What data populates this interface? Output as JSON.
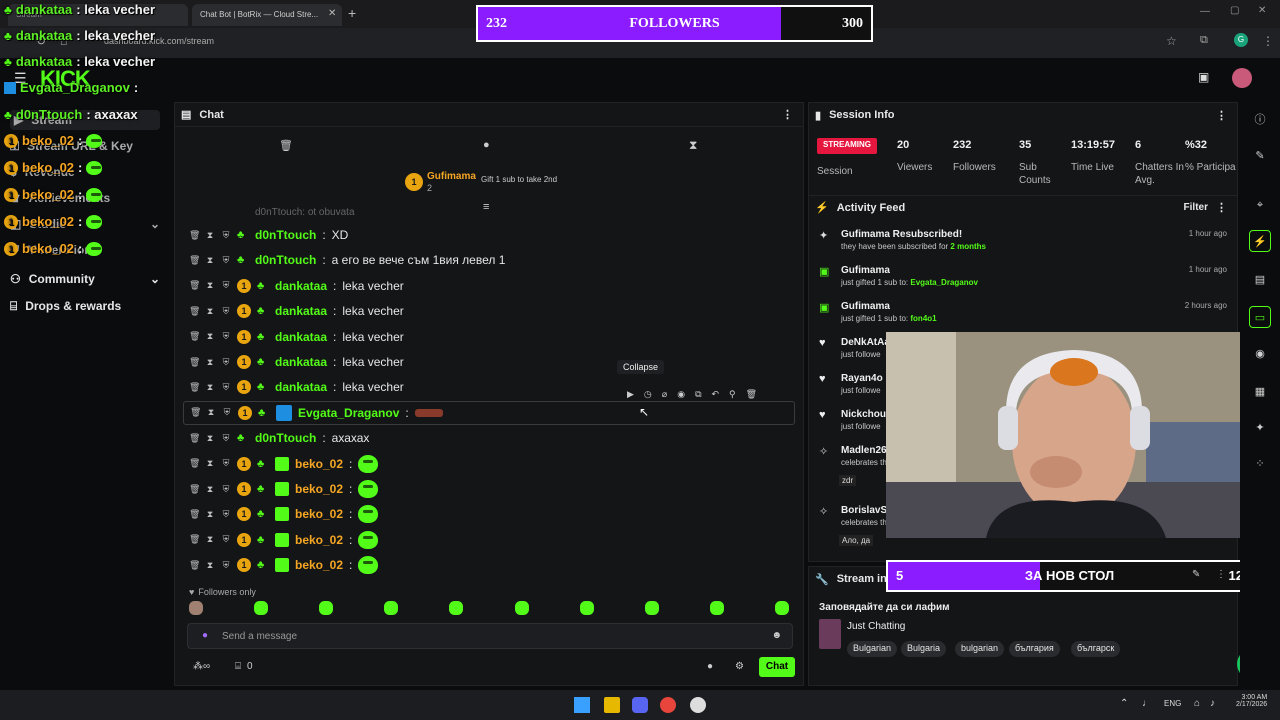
{
  "browser": {
    "tabs": [
      "Chat Bot | BotRix — Cloud Stre..."
    ],
    "url": "dashboard.kick.com/stream"
  },
  "followers_goal": {
    "current": "232",
    "label": "FOLLOWERS",
    "target": "300",
    "progress": 0.77
  },
  "nav": {
    "items": [
      "Stream",
      "Stream URL & Key",
      "Revenue",
      "Achievements",
      "Studio",
      "Moderation",
      "Community",
      "Drops & rewards"
    ]
  },
  "chat": {
    "title": "Chat",
    "pinned_user": "Gufimama",
    "pinned_count": "2",
    "pinned_gift_text": "Gift 1 sub to take 2nd",
    "partial_row": "d0nTtouch: ot obuvata",
    "messages": [
      {
        "user": "d0nTtouch",
        "text": "XD",
        "gold": false,
        "color": "#53fc18"
      },
      {
        "user": "d0nTtouch",
        "text": "а его ве вече съм 1вия левел 1",
        "gold": false,
        "color": "#53fc18"
      },
      {
        "user": "dankataa",
        "text": "leka vecher",
        "gold": true,
        "color": "#53fc18"
      },
      {
        "user": "dankataa",
        "text": "leka vecher",
        "gold": true,
        "color": "#53fc18"
      },
      {
        "user": "dankataa",
        "text": "leka vecher",
        "gold": true,
        "color": "#53fc18"
      },
      {
        "user": "dankataa",
        "text": "leka vecher",
        "gold": true,
        "color": "#53fc18"
      },
      {
        "user": "dankataa",
        "text": "leka vecher",
        "gold": true,
        "color": "#53fc18"
      },
      {
        "user": "Evgata_Draganov",
        "text": "",
        "gold": true,
        "color": "#53fc18"
      },
      {
        "user": "d0nTtouch",
        "text": "ахахах",
        "gold": false,
        "color": "#53fc18"
      },
      {
        "user": "beko_02",
        "text": "",
        "gold": true,
        "color": "#f5a623"
      },
      {
        "user": "beko_02",
        "text": "",
        "gold": true,
        "color": "#f5a623"
      },
      {
        "user": "beko_02",
        "text": "",
        "gold": true,
        "color": "#f5a623"
      },
      {
        "user": "beko_02",
        "text": "",
        "gold": true,
        "color": "#f5a623"
      },
      {
        "user": "beko_02",
        "text": "",
        "gold": true,
        "color": "#f5a623"
      }
    ],
    "tooltip": "Collapse",
    "followers_only": "Followers only",
    "input_placeholder": "Send a message",
    "footer_count": "0",
    "send_label": "Chat"
  },
  "session": {
    "title": "Session Info",
    "status": "STREAMING",
    "status_sub": "Session",
    "stats": [
      {
        "value": "20",
        "label": "Viewers"
      },
      {
        "value": "232",
        "label": "Followers"
      },
      {
        "value": "35",
        "label": "Sub Counts"
      },
      {
        "value": "13:19:57",
        "label": "Time Live"
      },
      {
        "value": "6",
        "label": "Chatters In Avg."
      },
      {
        "value": "%32",
        "label": "% Participa"
      }
    ]
  },
  "activity": {
    "title": "Activity Feed",
    "filter": "Filter",
    "items": [
      {
        "title": "Gufimama Resubscribed!",
        "sub": "they have been subscribed for ",
        "highlight": "2 months",
        "time": "1 hour ago",
        "icon": "star-icon"
      },
      {
        "title": "Gufimama",
        "sub": "just gifted 1 sub to: ",
        "highlight": "Evgata_Draganov",
        "time": "1 hour ago",
        "icon": "gift-icon"
      },
      {
        "title": "Gufimama",
        "sub": "just gifted 1 sub to: ",
        "highlight": "fon4o1",
        "time": "2 hours ago",
        "icon": "gift-icon"
      },
      {
        "title": "DeNkAtAa",
        "sub": "just followe",
        "highlight": "",
        "time": "",
        "icon": "heart-icon"
      },
      {
        "title": "Rayan4o",
        "sub": "just followe",
        "highlight": "",
        "time": "",
        "icon": "heart-icon"
      },
      {
        "title": "Nickchou",
        "sub": "just followe",
        "highlight": "",
        "time": "",
        "icon": "heart-icon"
      },
      {
        "title": "Madlen26",
        "sub": "celebrates th",
        "highlight": "",
        "time": "",
        "icon": "sub-icon"
      },
      {
        "title": "BorislavSir",
        "sub": "celebrates th",
        "highlight": "",
        "time": "",
        "icon": "sub-icon"
      }
    ],
    "msg_1": "zdr",
    "msg_2": "Ало, да"
  },
  "stream_info": {
    "title": "Stream info",
    "stream_title": "Заповядайте да си лафим",
    "category": "Just Chatting",
    "tags": [
      "Bulgarian",
      "Bulgaria",
      "bulgarian",
      "българия",
      "българск"
    ]
  },
  "sub_goal": {
    "current": "5",
    "label": "ЗА НОВ СТОЛ",
    "target": "12",
    "progress": 0.42
  },
  "overlay_chat": [
    {
      "name": "dankataa",
      "text": " : leka vecher",
      "color": "#5ef026"
    },
    {
      "name": "dankataa",
      "text": " : leka vecher",
      "color": "#5ef026"
    },
    {
      "name": "dankataa",
      "text": " : leka vecher",
      "color": "#5ef026"
    },
    {
      "name": "Evgata_Draganov",
      "text": " :",
      "color": "#5ef026"
    },
    {
      "name": "d0nTtouch",
      "text": " : ахахах",
      "color": "#5ef026"
    },
    {
      "name": "beko_02",
      "text": " :",
      "color": "#f5a623"
    },
    {
      "name": "beko_02",
      "text": " :",
      "color": "#f5a623"
    },
    {
      "name": "beko_02",
      "text": " :",
      "color": "#f5a623"
    },
    {
      "name": "beko_02",
      "text": " :",
      "color": "#f5a623"
    },
    {
      "name": "beko_02",
      "text": " :",
      "color": "#f5a623"
    }
  ],
  "taskbar": {
    "lang": "ENG",
    "time": "3:00 AM",
    "date": "2/17/2026"
  },
  "colors": {
    "kick_green": "#53fc18",
    "goal_purple": "#8a1cff",
    "streaming_red": "#e5173f"
  }
}
